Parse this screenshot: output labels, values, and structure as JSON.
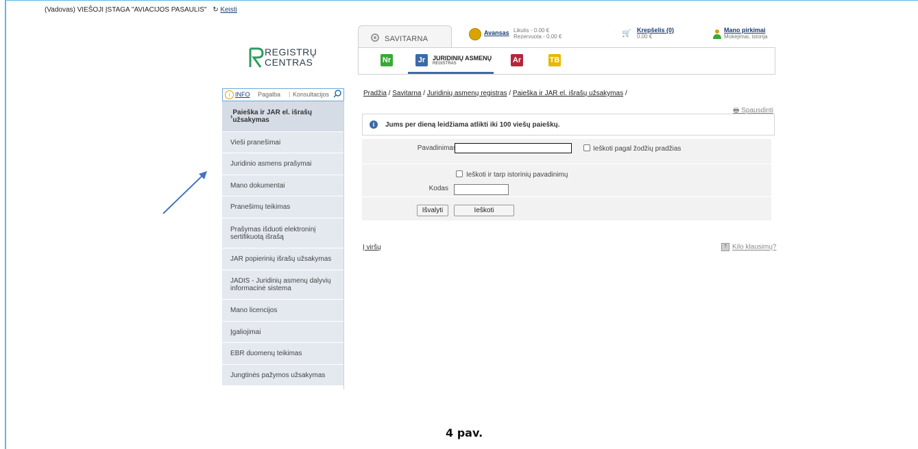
{
  "topbar": {
    "role": "(Vadovas)",
    "org": "VIEŠOJI ĮSTAGA \"AVIACIJOS PASAULIS\"",
    "change": "Keisti"
  },
  "logo": {
    "line1": "REGISTRŲ",
    "line2": "CENTRAS"
  },
  "header": {
    "tab": "SAVITARNA",
    "advance_label": "Avansas",
    "balance": "Likutis - 0.00 €",
    "reserved": "Rezervuota - 0.00 €",
    "cart": "Krepšelis (0)",
    "cart_sum": "0.00 €",
    "purchases": "Mano pirkimai",
    "purchases_sub": "Mokėjimai, istorija",
    "registers": [
      {
        "icon": "nr",
        "color": "#39a935"
      },
      {
        "icon": "jar",
        "color": "#3c6aa8",
        "title": "JURIDINIŲ ASMENŲ",
        "subtitle": "REGISTRAS"
      },
      {
        "icon": "ar",
        "color": "#b5263a"
      },
      {
        "icon": "tb",
        "color": "#e6b800"
      }
    ]
  },
  "sidebar": {
    "info": "INFO",
    "help": "Pagalba",
    "consult": "Konsultacijos",
    "items": [
      {
        "label": "Paieška ir JAR el. išrašų užsakymas",
        "prefix": "› "
      },
      {
        "label": "Vieši pranešimai"
      },
      {
        "label": "Juridinio asmens prašymai"
      },
      {
        "label": "Mano dokumentai"
      },
      {
        "label": "Pranešimų teikimas"
      },
      {
        "label": "Prašymas išduoti elektroninį sertifikuotą išrašą"
      },
      {
        "label": "JAR popierinių išrašų užsakymas"
      },
      {
        "label": "JADIS - Juridinių asmenų dalyvių informacinė sistema"
      },
      {
        "label": "Mano licencijos"
      },
      {
        "label": "Įgaliojimai"
      },
      {
        "label": "EBR duomenų teikimas"
      },
      {
        "label": "Jungtinės pažymos užsakymas"
      }
    ]
  },
  "breadcrumb": [
    "Pradžia",
    "Savitarna",
    "Juridinių asmenų registras",
    "Paieška ir JAR el. išrašų užsakymas"
  ],
  "print": "Spausdinti",
  "notice": "Jums per dieną leidžiama atlikti iki 100 viešų paieškų.",
  "form": {
    "name_label": "Pavadinimas",
    "name_value": "",
    "starts_with": "Ieškoti pagal žodžių pradžias",
    "history": "Ieškoti ir tarp istorinių pavadinimų",
    "code_label": "Kodas",
    "code_value": "",
    "clear": "Išvalyti",
    "search": "Ieškoti"
  },
  "to_top": "Į viršų",
  "faq": "Kilo klausimų?",
  "caption": "4 pav."
}
